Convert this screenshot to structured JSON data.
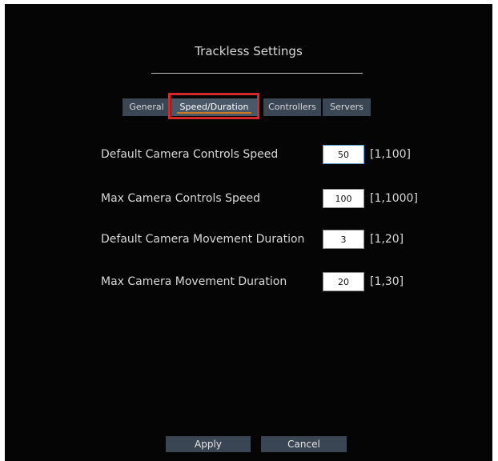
{
  "dialog": {
    "title": "Trackless Settings"
  },
  "tabs": [
    {
      "label": "General",
      "active": false
    },
    {
      "label": "Speed/Duration",
      "active": true
    },
    {
      "label": "Controllers",
      "active": false
    },
    {
      "label": "Servers",
      "active": false
    }
  ],
  "settings": [
    {
      "label": "Default Camera Controls Speed",
      "value": "50",
      "range": "[1,100]"
    },
    {
      "label": "Max Camera Controls Speed",
      "value": "100",
      "range": "[1,1000]"
    },
    {
      "label": "Default Camera Movement Duration",
      "value": "3",
      "range": "[1,20]"
    },
    {
      "label": "Max Camera Movement Duration",
      "value": "20",
      "range": "[1,30]"
    }
  ],
  "buttons": {
    "apply": "Apply",
    "cancel": "Cancel"
  },
  "colors": {
    "panel_background": "#050505",
    "tab_background": "#3b4654",
    "active_tab_underline": "#d07a1e",
    "highlight_border": "#d62828",
    "focused_field_border": "#5b9bd5"
  }
}
